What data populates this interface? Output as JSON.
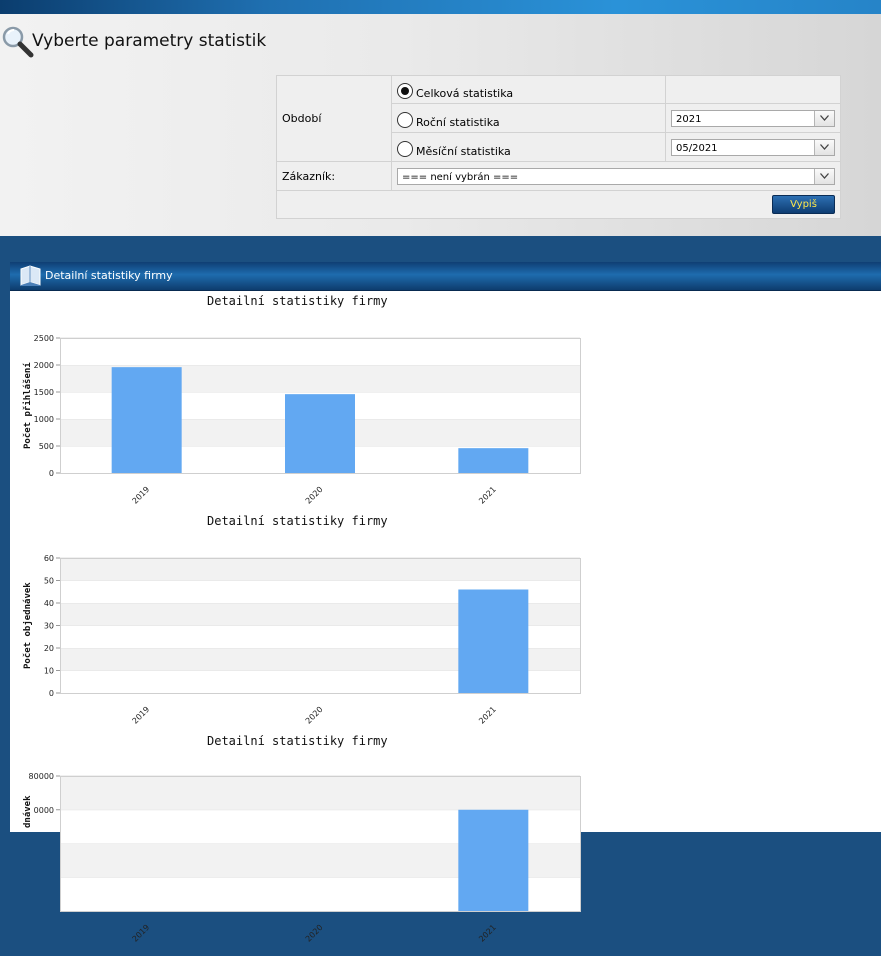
{
  "params": {
    "title": "Vyberte parametry statistik",
    "period_label": "Období",
    "options": [
      {
        "label": "Celková statistika",
        "selected": true
      },
      {
        "label": "Roční statistika",
        "selected": false
      },
      {
        "label": "Měsíční statistika",
        "selected": false
      }
    ],
    "year_value": "2021",
    "month_value": "05/2021",
    "customer_label": "Zákazník:",
    "customer_value": "=== není vybrán ===",
    "submit_label": "Vypiš"
  },
  "panel": {
    "title": "Detailní statistiky firmy"
  },
  "colors": {
    "bar": "#62a8f2",
    "band": "#f2f2f2"
  },
  "chart_data": [
    {
      "type": "bar",
      "title": "Detailní statistiky firmy",
      "ylabel": "Počet přihlášení",
      "categories": [
        "2019",
        "2020",
        "2021"
      ],
      "values": [
        1960,
        1460,
        460
      ],
      "ylim": [
        0,
        2500
      ],
      "yticks": [
        0,
        500,
        1000,
        1500,
        2000,
        2500
      ],
      "ytick_labels": [
        "0",
        "500",
        "1000",
        "1500",
        "2000",
        "2500"
      ]
    },
    {
      "type": "bar",
      "title": "Detailní statistiky firmy",
      "ylabel": "Počet objednávek",
      "categories": [
        "2019",
        "2020",
        "2021"
      ],
      "values": [
        0,
        0,
        46
      ],
      "ylim": [
        0,
        60
      ],
      "yticks": [
        0,
        10,
        20,
        30,
        40,
        50,
        60
      ],
      "ytick_labels": [
        "0",
        "10",
        "20",
        "30",
        "40",
        "50",
        "60"
      ]
    },
    {
      "type": "bar",
      "title": "Detailní statistiky firmy",
      "ylabel": "dnávek",
      "categories": [
        "2019",
        "2020",
        "2021"
      ],
      "values": [
        0,
        0,
        60000
      ],
      "ylim": [
        0,
        80000
      ],
      "yticks": [
        60000,
        80000
      ],
      "ytick_labels": [
        "0000",
        "80000"
      ]
    }
  ]
}
